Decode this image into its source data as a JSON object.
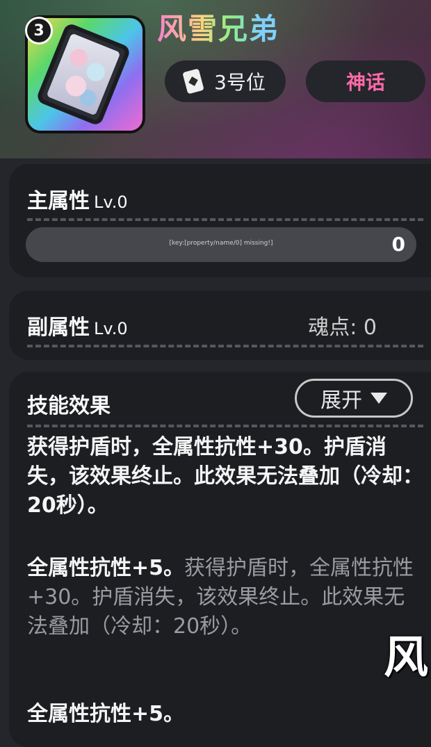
{
  "item": {
    "name": "风雪兄弟",
    "level": "3",
    "slot_label": "3号位",
    "rarity": "神话",
    "slot_icon": "card-icon",
    "rarity_color": "#ff6aa8"
  },
  "main_attr": {
    "title": "主属性",
    "level": "Lv.0",
    "bar_label": "[key:[property/name/0] missing!]",
    "bar_value": "0"
  },
  "sub_attr": {
    "title": "副属性",
    "level": "Lv.0",
    "soul_points": "魂点: 0"
  },
  "skill": {
    "title": "技能效果",
    "expand_label": "展开",
    "effect1": "获得护盾时，全属性抗性+30。护盾消失，该效果终止。此效果无法叠加（冷却：20秒）。",
    "effect2_bold": "全属性抗性+5。",
    "effect2_dim": "获得护盾时，全属性抗性+30。护盾消失，该效果终止。此效果无法叠加（冷却：20秒）。",
    "effect3": "全属性抗性+5。"
  },
  "watermark": "风"
}
